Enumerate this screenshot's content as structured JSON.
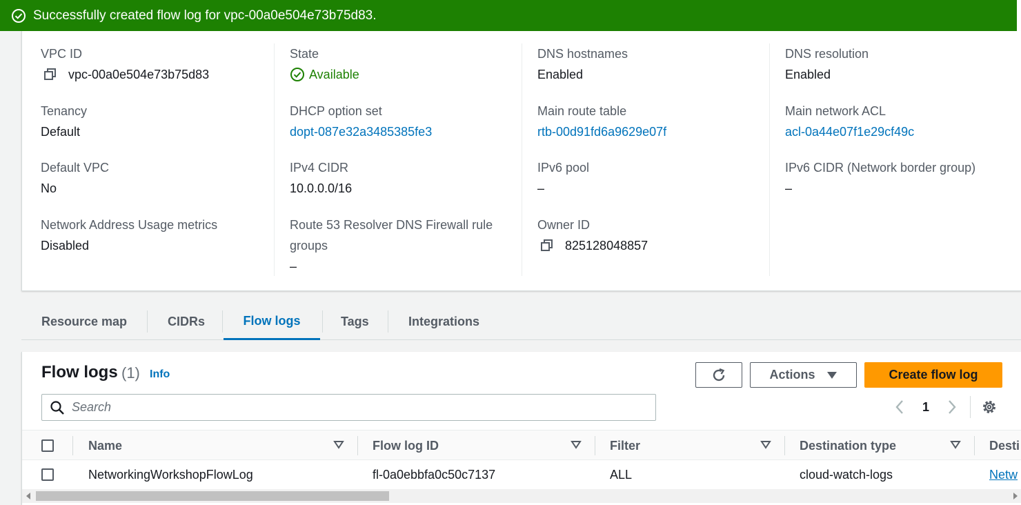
{
  "banner": {
    "message": "Successfully created flow log for vpc-00a0e504e73b75d83.",
    "color": "#1d8102"
  },
  "details": {
    "vpc_id": {
      "label": "VPC ID",
      "value": "vpc-00a0e504e73b75d83"
    },
    "state": {
      "label": "State",
      "value": "Available"
    },
    "dns_hostnames": {
      "label": "DNS hostnames",
      "value": "Enabled"
    },
    "dns_resolution": {
      "label": "DNS resolution",
      "value": "Enabled"
    },
    "tenancy": {
      "label": "Tenancy",
      "value": "Default"
    },
    "dhcp_option_set": {
      "label": "DHCP option set",
      "value": "dopt-087e32a3485385fe3"
    },
    "main_route_table": {
      "label": "Main route table",
      "value": "rtb-00d91fd6a9629e07f"
    },
    "main_network_acl": {
      "label": "Main network ACL",
      "value": "acl-0a44e07f1e29cf49c"
    },
    "default_vpc": {
      "label": "Default VPC",
      "value": "No"
    },
    "ipv4_cidr": {
      "label": "IPv4 CIDR",
      "value": "10.0.0.0/16"
    },
    "ipv6_pool": {
      "label": "IPv6 pool",
      "value": "–"
    },
    "ipv6_cidr": {
      "label": "IPv6 CIDR (Network border group)",
      "value": "–"
    },
    "network_address_usage": {
      "label": "Network Address Usage metrics",
      "value": "Disabled"
    },
    "route53_firewall": {
      "label_line1": "Route 53 Resolver DNS Firewall rule",
      "label_line2": "groups",
      "value": "–"
    },
    "owner_id": {
      "label": "Owner ID",
      "value": "825128048857"
    }
  },
  "tabs": [
    {
      "label": "Resource map"
    },
    {
      "label": "CIDRs"
    },
    {
      "label": "Flow logs",
      "active": true
    },
    {
      "label": "Tags"
    },
    {
      "label": "Integrations"
    }
  ],
  "flow_logs": {
    "title": "Flow logs",
    "count": "(1)",
    "info_label": "Info",
    "actions_label": "Actions",
    "create_label": "Create flow log",
    "search_placeholder": "Search",
    "page_number": "1",
    "columns": [
      "Name",
      "Flow log ID",
      "Filter",
      "Destination type",
      "Desti"
    ],
    "rows": [
      {
        "name": "NetworkingWorkshopFlowLog",
        "flow_log_id": "fl-0a0ebbfa0c50c7137",
        "filter": "ALL",
        "destination_type": "cloud-watch-logs",
        "destination": "Netw"
      }
    ]
  },
  "colors": {
    "accent": "#0073bb",
    "primary_button": "#ff9900",
    "success": "#1d8102"
  },
  "icons": [
    "success-check-icon",
    "copy-icon",
    "refresh-icon",
    "caret-down-icon",
    "search-icon",
    "chevron-left-icon",
    "chevron-right-icon",
    "settings-gear-icon",
    "sort-caret-icon"
  ]
}
